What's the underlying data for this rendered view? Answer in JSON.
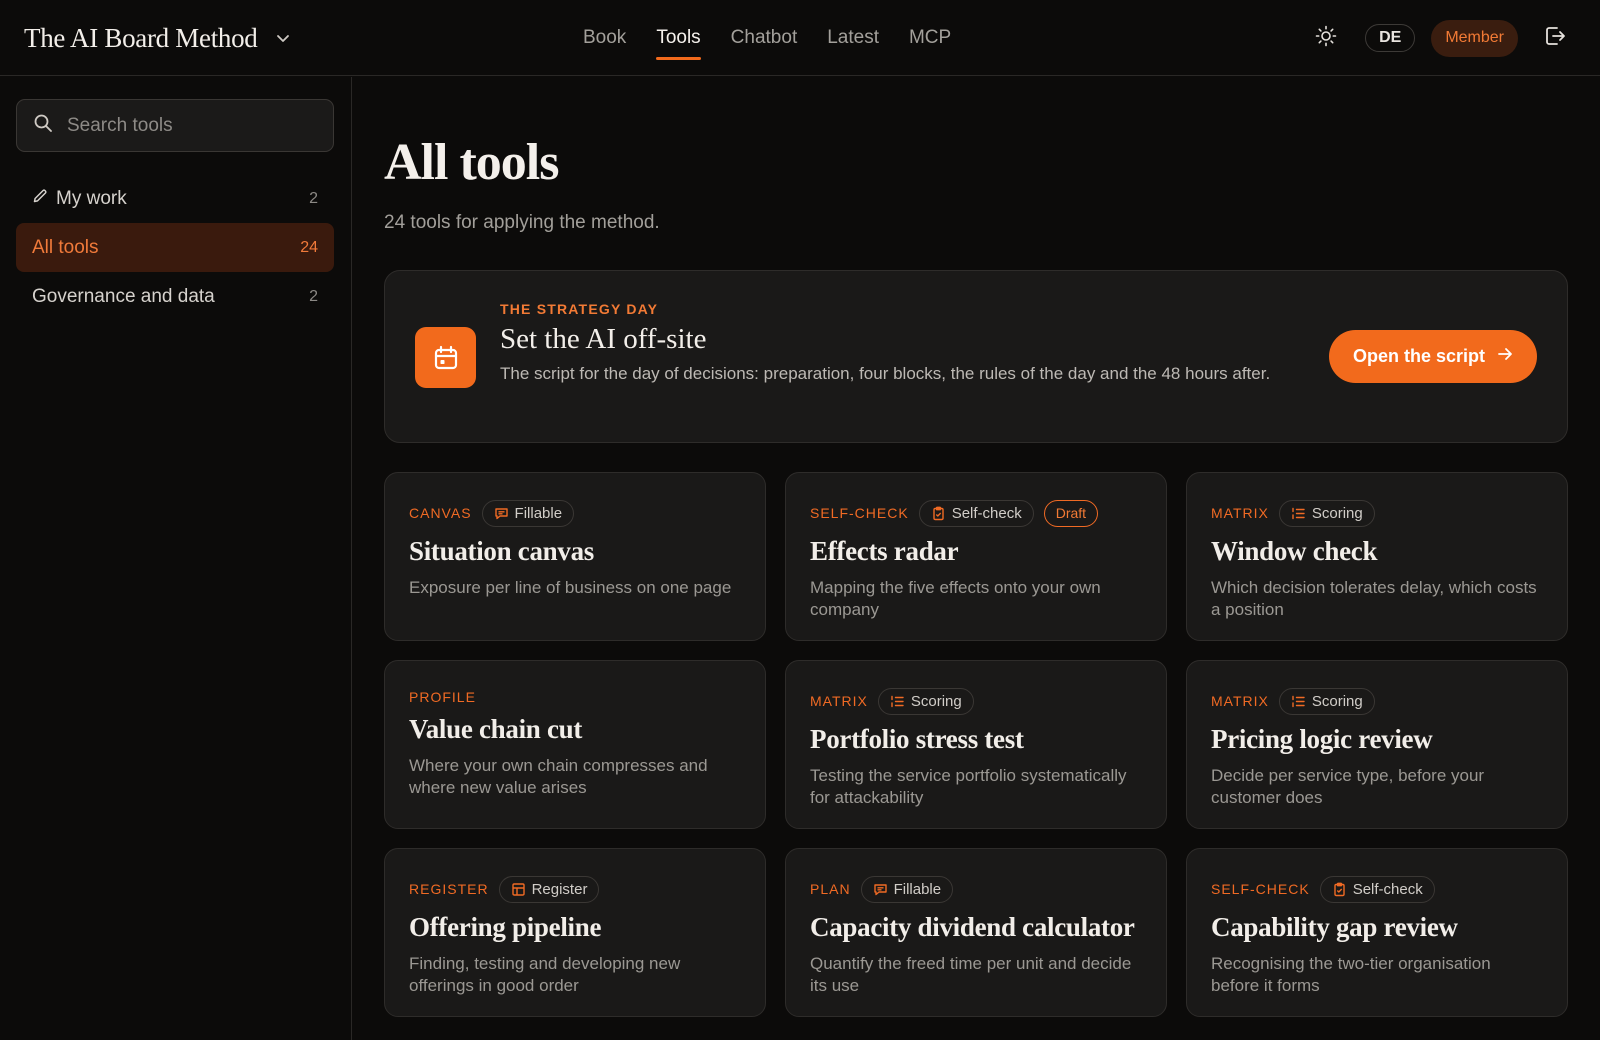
{
  "header": {
    "brand": "The AI Board Method",
    "nav": [
      "Book",
      "Tools",
      "Chatbot",
      "Latest",
      "MCP"
    ],
    "active_nav": "Tools",
    "lang": "DE",
    "member": "Member"
  },
  "sidebar": {
    "search_placeholder": "Search tools",
    "items": [
      {
        "label": "My work",
        "count": "2",
        "icon": "pencil-icon"
      },
      {
        "label": "All tools",
        "count": "24",
        "active": true
      },
      {
        "label": "Governance and data",
        "count": "2"
      }
    ]
  },
  "main": {
    "title": "All tools",
    "subtitle": "24 tools for applying the method.",
    "feature": {
      "kicker": "THE STRATEGY DAY",
      "title": "Set the AI off-site",
      "description": "The script for the day of decisions: preparation, four blocks, the rules of the day and the 48 hours after.",
      "button": "Open the script",
      "icon": "calendar-icon"
    },
    "cards": [
      {
        "type": "CANVAS",
        "chip": "Fillable",
        "chip_icon": "comment-icon",
        "title": "Situation canvas",
        "desc": "Exposure per line of business on one page"
      },
      {
        "type": "SELF-CHECK",
        "chip": "Self-check",
        "chip_icon": "clipboard-icon",
        "draft": "Draft",
        "title": "Effects radar",
        "desc": "Mapping the five effects onto your own company"
      },
      {
        "type": "MATRIX",
        "chip": "Scoring",
        "chip_icon": "list-icon",
        "title": "Window check",
        "desc": "Which decision tolerates delay, which costs a position"
      },
      {
        "type": "PROFILE",
        "title": "Value chain cut",
        "desc": "Where your own chain compresses and where new value arises"
      },
      {
        "type": "MATRIX",
        "chip": "Scoring",
        "chip_icon": "list-icon",
        "title": "Portfolio stress test",
        "desc": "Testing the service portfolio systematically for attackability"
      },
      {
        "type": "MATRIX",
        "chip": "Scoring",
        "chip_icon": "list-icon",
        "title": "Pricing logic review",
        "desc": "Decide per service type, before your customer does"
      },
      {
        "type": "REGISTER",
        "chip": "Register",
        "chip_icon": "table-icon",
        "title": "Offering pipeline",
        "desc": "Finding, testing and developing new offerings in good order"
      },
      {
        "type": "PLAN",
        "chip": "Fillable",
        "chip_icon": "comment-icon",
        "title": "Capacity dividend calculator",
        "desc": "Quantify the freed time per unit and decide its use"
      },
      {
        "type": "SELF-CHECK",
        "chip": "Self-check",
        "chip_icon": "clipboard-icon",
        "title": "Capability gap review",
        "desc": "Recognising the two-tier organisation before it forms"
      }
    ]
  },
  "colors": {
    "accent": "#f26a1c",
    "background": "#0c0b0a",
    "card": "#1a1918"
  }
}
